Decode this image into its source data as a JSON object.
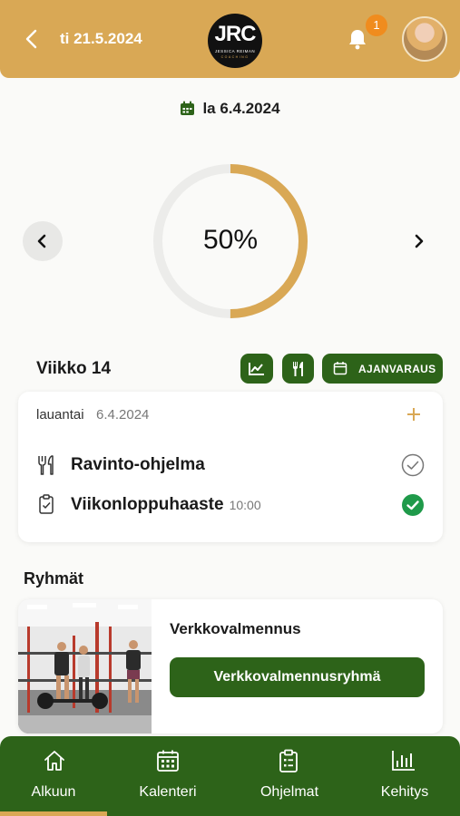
{
  "header": {
    "date": "ti 21.5.2024",
    "logo_text": "JRC",
    "logo_subtitle": "JESSICA REIMAN",
    "logo_subtitle2": "COACHING",
    "notification_count": "1"
  },
  "selected_date": "la 6.4.2024",
  "progress": {
    "value": 0.5,
    "label": "50%"
  },
  "week": {
    "title": "Viikko 14",
    "booking_label": "AJANVARAUS"
  },
  "day_card": {
    "day_name": "lauantai",
    "date": "6.4.2024",
    "items": [
      {
        "label": "Ravinto-ohjelma",
        "time": "",
        "done": false,
        "icon": "utensils-icon"
      },
      {
        "label": "Viikonloppuhaaste",
        "time": "10:00",
        "done": true,
        "icon": "clipboard-icon"
      }
    ]
  },
  "groups": {
    "title": "Ryhmät",
    "card": {
      "name": "Verkkovalmennus",
      "button_label": "Verkkovalmennusryhmä"
    }
  },
  "nav": {
    "tabs": [
      {
        "label": "Alkuun",
        "icon": "home-icon",
        "active": true
      },
      {
        "label": "Kalenteri",
        "icon": "calendar-icon",
        "active": false
      },
      {
        "label": "Ohjelmat",
        "icon": "clipboard-list-icon",
        "active": false
      },
      {
        "label": "Kehitys",
        "icon": "bar-chart-icon",
        "active": false
      }
    ]
  },
  "colors": {
    "header": "#d9a855",
    "accent_green": "#2d6319",
    "check_green": "#1f9a4a",
    "badge": "#f08c1e"
  }
}
